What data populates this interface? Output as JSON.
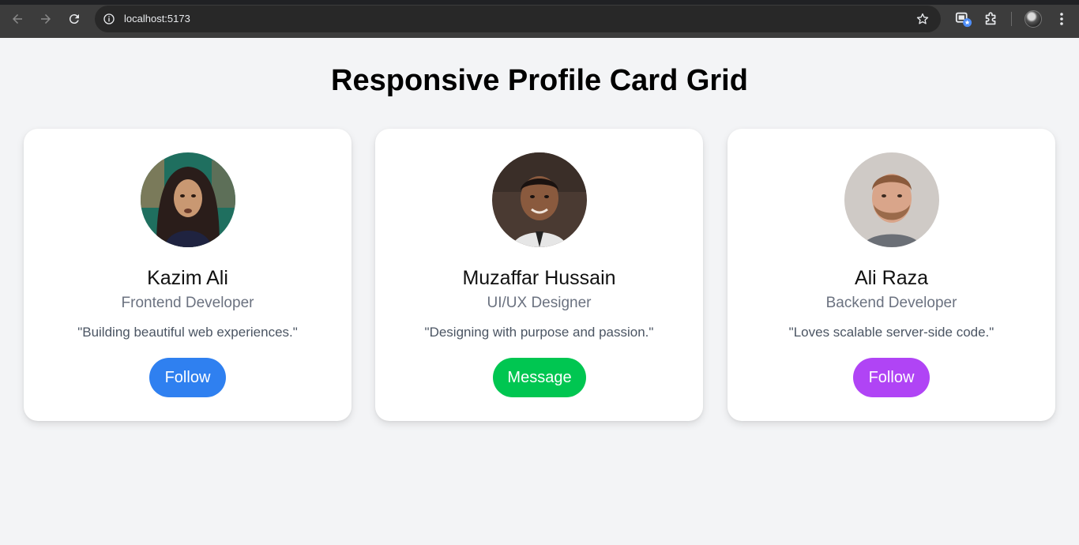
{
  "browser": {
    "url": "localhost:5173",
    "icons": [
      "back-arrow-icon",
      "forward-arrow-icon",
      "reload-icon",
      "site-info-icon",
      "bookmark-star-icon",
      "extension-badge-icon",
      "puzzle-extensions-icon",
      "profile-avatar",
      "more-menu-icon"
    ]
  },
  "page": {
    "title": "Responsive Profile Card Grid"
  },
  "cards": [
    {
      "name": "Kazim Ali",
      "role": "Frontend Developer",
      "quote": "\"Building beautiful web experiences.\"",
      "button": "Follow",
      "button_color": "#2f80f0"
    },
    {
      "name": "Muzaffar Hussain",
      "role": "UI/UX Designer",
      "quote": "\"Designing with purpose and passion.\"",
      "button": "Message",
      "button_color": "#00c651"
    },
    {
      "name": "Ali Raza",
      "role": "Backend Developer",
      "quote": "\"Loves scalable server-side code.\"",
      "button": "Follow",
      "button_color": "#b044f5"
    }
  ],
  "colors": {
    "page_background": "#f3f4f6",
    "card_background": "#ffffff",
    "role_text": "#6b7280"
  }
}
